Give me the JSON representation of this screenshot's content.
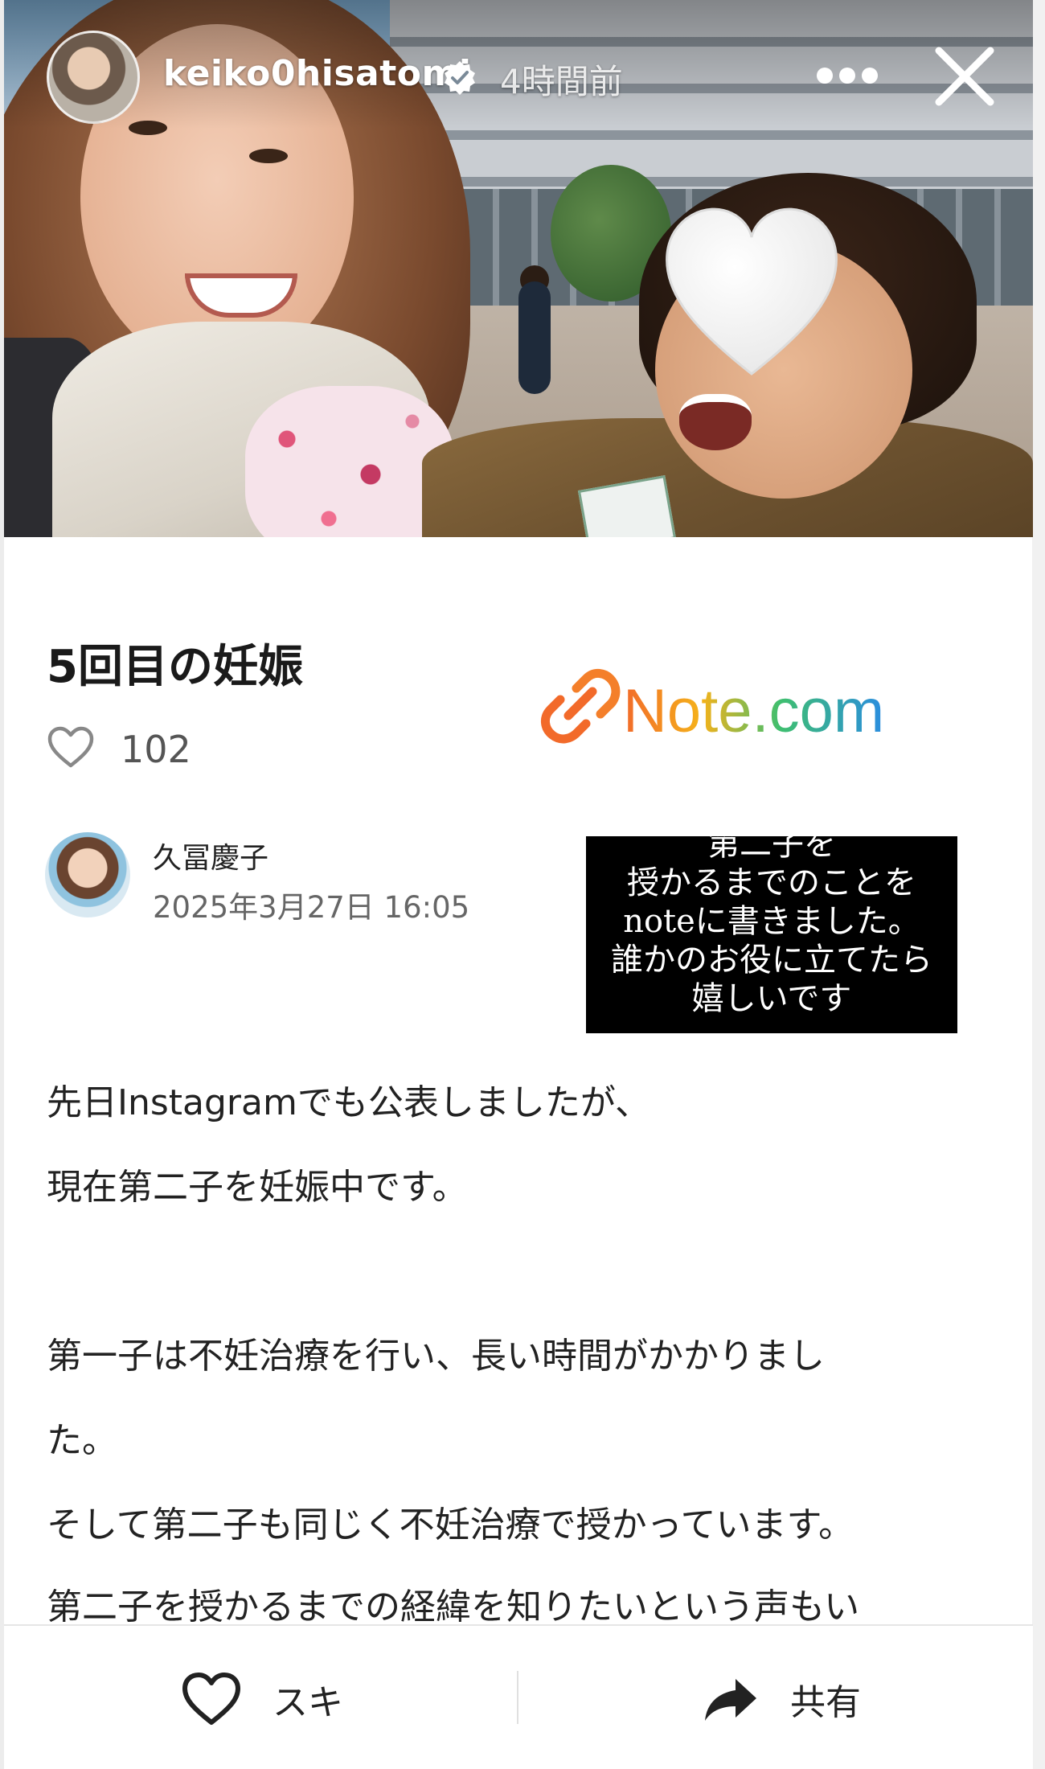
{
  "story": {
    "username": "keiko0hisatomi",
    "time_ago": "4時間前",
    "icons": {
      "verified": "verified-badge-icon",
      "more": "more-dots-icon",
      "close": "close-icon"
    }
  },
  "note": {
    "title": "5回目の妊娠",
    "like_count": "102",
    "logo_text": "Note.com",
    "author": {
      "name": "久冨慶子",
      "date": "2025年3月27日 16:05"
    },
    "caption_lines": [
      "第二子を",
      "授かるまでのことを",
      "noteに書きました。",
      "誰かのお役に立てたら",
      "嬉しいです"
    ],
    "body_lines": [
      "先日Instagramでも公表しましたが、",
      "現在第二子を妊娠中です。",
      "第一子は不妊治療を行い、長い時間がかかりまし",
      "た。",
      "そして第二子も同じく不妊治療で授かっています。",
      "第二子を授かるまでの経緯を知りたいという声もい"
    ]
  },
  "bottom_bar": {
    "like_label": "スキ",
    "share_label": "共有"
  },
  "colors": {
    "logo_gradient": [
      "#f26a2a",
      "#f5b21a",
      "#3fbf6f",
      "#2a8de0"
    ],
    "caption_bg": "#000000"
  }
}
